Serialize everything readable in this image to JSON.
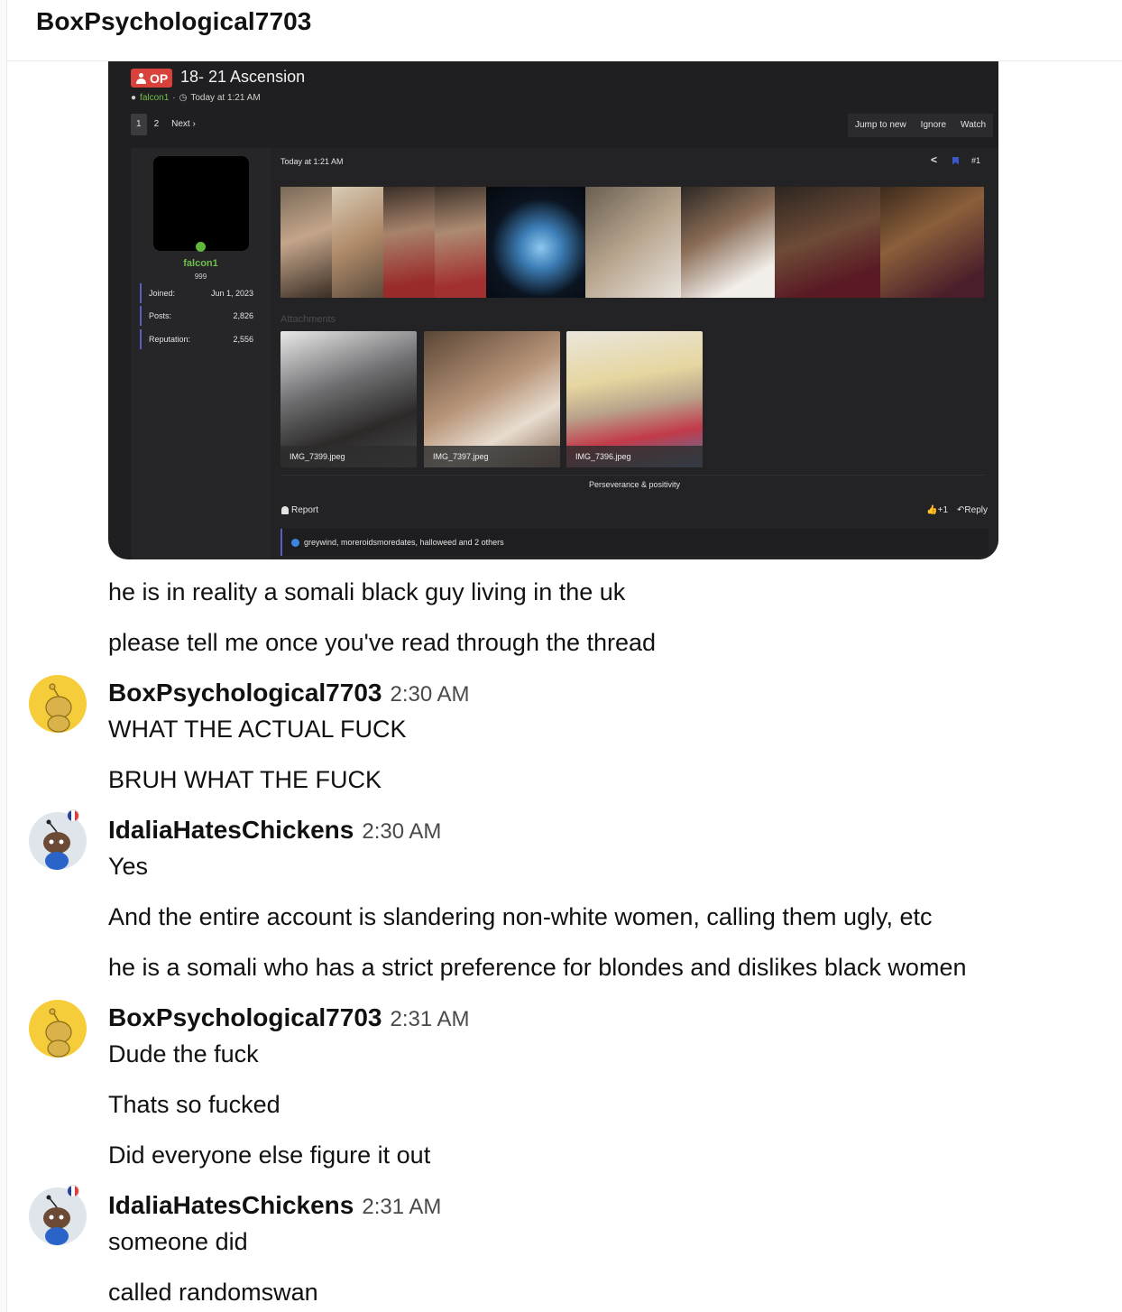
{
  "header": {
    "title": "BoxPsychological7703"
  },
  "forum_post": {
    "op_badge": "OP",
    "thread_title": "18- 21 Ascension",
    "author": "falcon1",
    "meta_separator": "·",
    "posted": "Today at 1:21 AM",
    "pages": [
      "1",
      "2"
    ],
    "next_label": "Next ›",
    "top_buttons": [
      "Jump to new",
      "Ignore",
      "Watch"
    ],
    "user": {
      "name": "falcon1",
      "count": "999",
      "stats": [
        {
          "label": "Joined:",
          "value": "Jun 1, 2023"
        },
        {
          "label": "Posts:",
          "value": "2,826"
        },
        {
          "label": "Reputation:",
          "value": "2,556"
        }
      ]
    },
    "post_time": "Today at 1:21 AM",
    "post_number": "#1",
    "attachments_label": "Attachments",
    "attachments": [
      "IMG_7399.jpeg",
      "IMG_7397.jpeg",
      "IMG_7396.jpeg"
    ],
    "signature": "Perseverance & positivity",
    "report_label": "Report",
    "like_count": "+1",
    "reply_label": "Reply",
    "likes_text": "greywind, moreroidsmoredates, halloweed and 2 others"
  },
  "messages": {
    "m1": "he is in reality a somali black guy living in the uk",
    "m2": "please tell me once you've read through the thread",
    "g1": {
      "name": "BoxPsychological7703",
      "time": "2:30 AM",
      "lines": [
        "WHAT THE ACTUAL FUCK",
        "BRUH WHAT THE FUCK"
      ]
    },
    "g2": {
      "name": "IdaliaHatesChickens",
      "time": "2:30 AM",
      "lines": [
        "Yes",
        "And the entire account is slandering non-white women, calling them ugly, etc",
        "he is a somali who has a strict preference for blondes and dislikes black women"
      ]
    },
    "g3": {
      "name": "BoxPsychological7703",
      "time": "2:31 AM",
      "lines": [
        "Dude the fuck",
        "Thats so fucked",
        "Did everyone else figure it out"
      ]
    },
    "g4": {
      "name": "IdaliaHatesChickens",
      "time": "2:31 AM",
      "lines": [
        "someone did",
        "called randomswan"
      ]
    }
  },
  "colors": {
    "forum_bg": "#1f1f21",
    "op_red": "#d9413b",
    "author_green": "#6fbf4a",
    "accent_purple": "#5a5fc8",
    "avatar_yellow": "#f5cd3a"
  }
}
